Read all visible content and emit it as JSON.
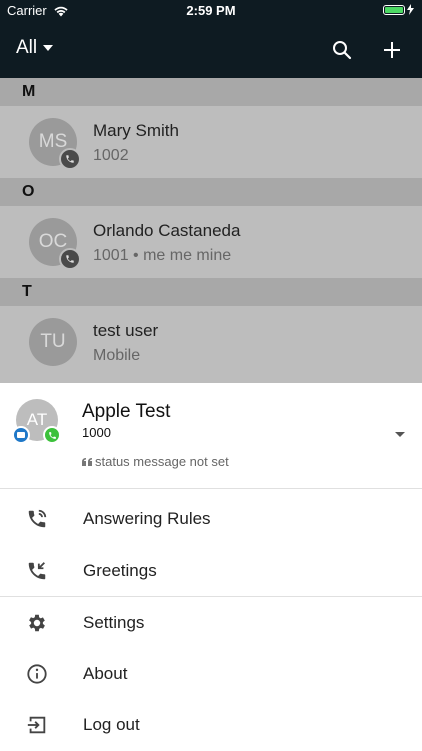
{
  "status_bar": {
    "carrier": "Carrier",
    "time": "2:59 PM"
  },
  "app_bar": {
    "filter_label": "All"
  },
  "sections": [
    {
      "letter": "M",
      "contacts": [
        {
          "initials": "MS",
          "name": "Mary Smith",
          "sub": "1002"
        }
      ]
    },
    {
      "letter": "O",
      "contacts": [
        {
          "initials": "OC",
          "name": "Orlando Castaneda",
          "sub": "1001 • me me mine"
        }
      ]
    },
    {
      "letter": "T",
      "contacts": [
        {
          "initials": "TU",
          "name": "test user",
          "sub": "Mobile"
        }
      ]
    }
  ],
  "profile": {
    "initials": "AT",
    "name": "Apple Test",
    "extension": "1000",
    "status_message": "status message not set"
  },
  "menu": [
    {
      "label": "Answering Rules",
      "icon": "answering-rules-icon"
    },
    {
      "label": "Greetings",
      "icon": "greetings-icon"
    },
    {
      "label": "Settings",
      "icon": "gear-icon"
    },
    {
      "label": "About",
      "icon": "info-icon"
    },
    {
      "label": "Log out",
      "icon": "logout-icon"
    }
  ],
  "colors": {
    "appbar": "#0e1b22",
    "overlay_list": "#bdbdbd",
    "chat_badge": "#1f78c8",
    "call_badge": "#3cc13b",
    "battery": "#4cd964"
  }
}
